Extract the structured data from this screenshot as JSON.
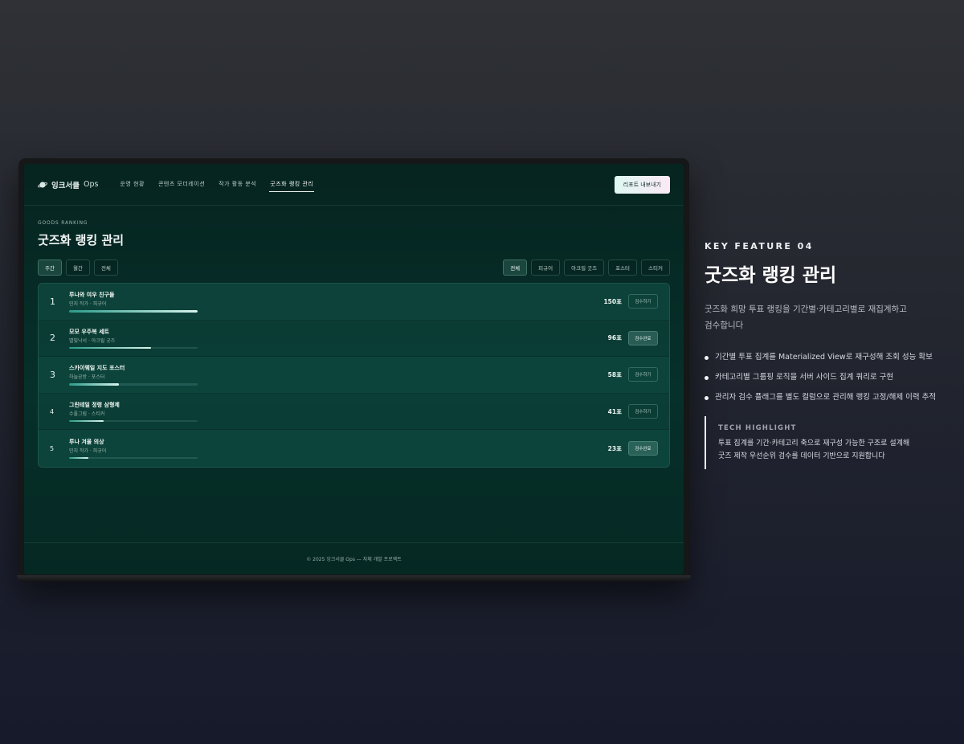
{
  "app": {
    "brand_name": "잉크서클",
    "brand_suffix": "Ops",
    "nav": [
      "운영 현황",
      "콘텐츠 모더레이션",
      "작가 활동 분석",
      "굿즈화 랭킹 관리"
    ],
    "active_nav": 3,
    "export_label": "리포트 내보내기"
  },
  "page": {
    "eyebrow": "GOODS RANKING",
    "title": "굿즈화 랭킹 관리",
    "period_filters": [
      "주간",
      "월간",
      "전체"
    ],
    "active_period": 0,
    "category_filters": [
      "전체",
      "피규어",
      "아크릴 굿즈",
      "포스터",
      "스티커"
    ],
    "active_category": 0
  },
  "rankings": [
    {
      "rank": "1",
      "name": "루나와 여우 친구들",
      "meta": "민지 작가 · 피규어",
      "votes": "150표",
      "progress": 1.0,
      "action": "검수하기",
      "reviewed": false
    },
    {
      "rank": "2",
      "name": "모모 우주복 세트",
      "meta": "별빛낙서 · 아크릴 굿즈",
      "votes": "96표",
      "progress": 0.64,
      "action": "검수완료",
      "reviewed": true
    },
    {
      "rank": "3",
      "name": "스카이웨일 지도 포스터",
      "meta": "하늘공방 · 포스터",
      "votes": "58표",
      "progress": 0.39,
      "action": "검수하기",
      "reviewed": false
    },
    {
      "rank": "4",
      "name": "그린테일 정령 삼형제",
      "meta": "수풀그림 · 스티커",
      "votes": "41표",
      "progress": 0.27,
      "action": "검수하기",
      "reviewed": false
    },
    {
      "rank": "5",
      "name": "루나 겨울 의상",
      "meta": "민지 작가 · 피규어",
      "votes": "23표",
      "progress": 0.15,
      "action": "검수완료",
      "reviewed": true
    }
  ],
  "footer": "© 2025 잉크서클 Ops — 자체 개발 프로젝트",
  "feature": {
    "eyebrow": "KEY FEATURE 04",
    "title": "굿즈화 랭킹 관리",
    "desc_line1": "굿즈화 희망 투표 랭킹을 기간별·카테고리별로 재집계하고",
    "desc_line2": "검수합니다",
    "bullets": [
      "기간별 투표 집계를 Materialized View로 재구성해 조회 성능 확보",
      "카테고리별 그룹핑 로직을 서버 사이드 집계 쿼리로 구현",
      "관리자 검수 플래그를 별도 컬럼으로 관리해 랭킹 고정/해제 이력 추적"
    ],
    "highlight_title": "TECH HIGHLIGHT",
    "highlight_line1": "투표 집계를 기간·카테고리 축으로 재구성 가능한 구조로 설계해",
    "highlight_line2": "굿즈 제작 우선순위 검수를 데이터 기반으로 지원합니다"
  }
}
